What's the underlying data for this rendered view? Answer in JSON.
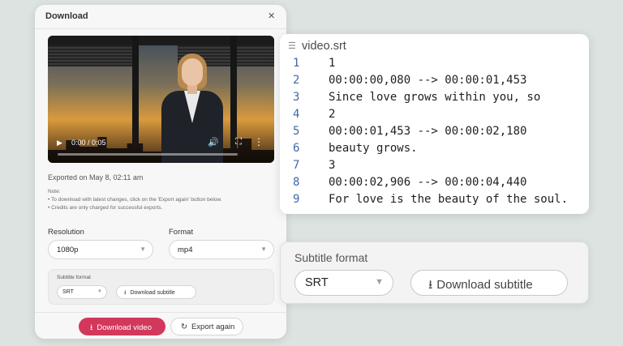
{
  "dialog": {
    "title": "Download",
    "close_icon": "×",
    "video": {
      "time": "0:00 / 0:05",
      "play_icon": "▶",
      "volume_icon": "🔊",
      "fullscreen_icon": "⛶",
      "more_icon": "⋮"
    },
    "exported_text": "Exported on May 8, 02:11 am",
    "note": {
      "heading": "Note:",
      "items": [
        "• To download with latest changes, click on the 'Export again' button below.",
        "• Credits are only charged for successful exports."
      ]
    },
    "resolution": {
      "label": "Resolution",
      "value": "1080p"
    },
    "format": {
      "label": "Format",
      "value": "mp4"
    },
    "subtitle": {
      "label": "Subtitle format",
      "value": "SRT",
      "button": "Download subtitle"
    },
    "download_button": "Download video",
    "export_button": "Export again"
  },
  "code_card": {
    "title": "video.srt",
    "lines": [
      {
        "num": "1",
        "text": "1"
      },
      {
        "num": "2",
        "text": "00:00:00,080 --> 00:00:01,453"
      },
      {
        "num": "3",
        "text": "Since love grows within you, so"
      },
      {
        "num": "4",
        "text": "2"
      },
      {
        "num": "5",
        "text": "00:00:01,453 --> 00:00:02,180"
      },
      {
        "num": "6",
        "text": "beauty grows."
      },
      {
        "num": "7",
        "text": "3"
      },
      {
        "num": "8",
        "text": "00:00:02,906 --> 00:00:04,440"
      },
      {
        "num": "9",
        "text": "For love is the beauty of the soul."
      }
    ]
  },
  "subtitle_card": {
    "label": "Subtitle format",
    "value": "SRT",
    "button": "Download subtitle"
  },
  "colors": {
    "background": "#dce3e0",
    "primary": "#d2385c",
    "line_number": "#3d6aa6"
  }
}
